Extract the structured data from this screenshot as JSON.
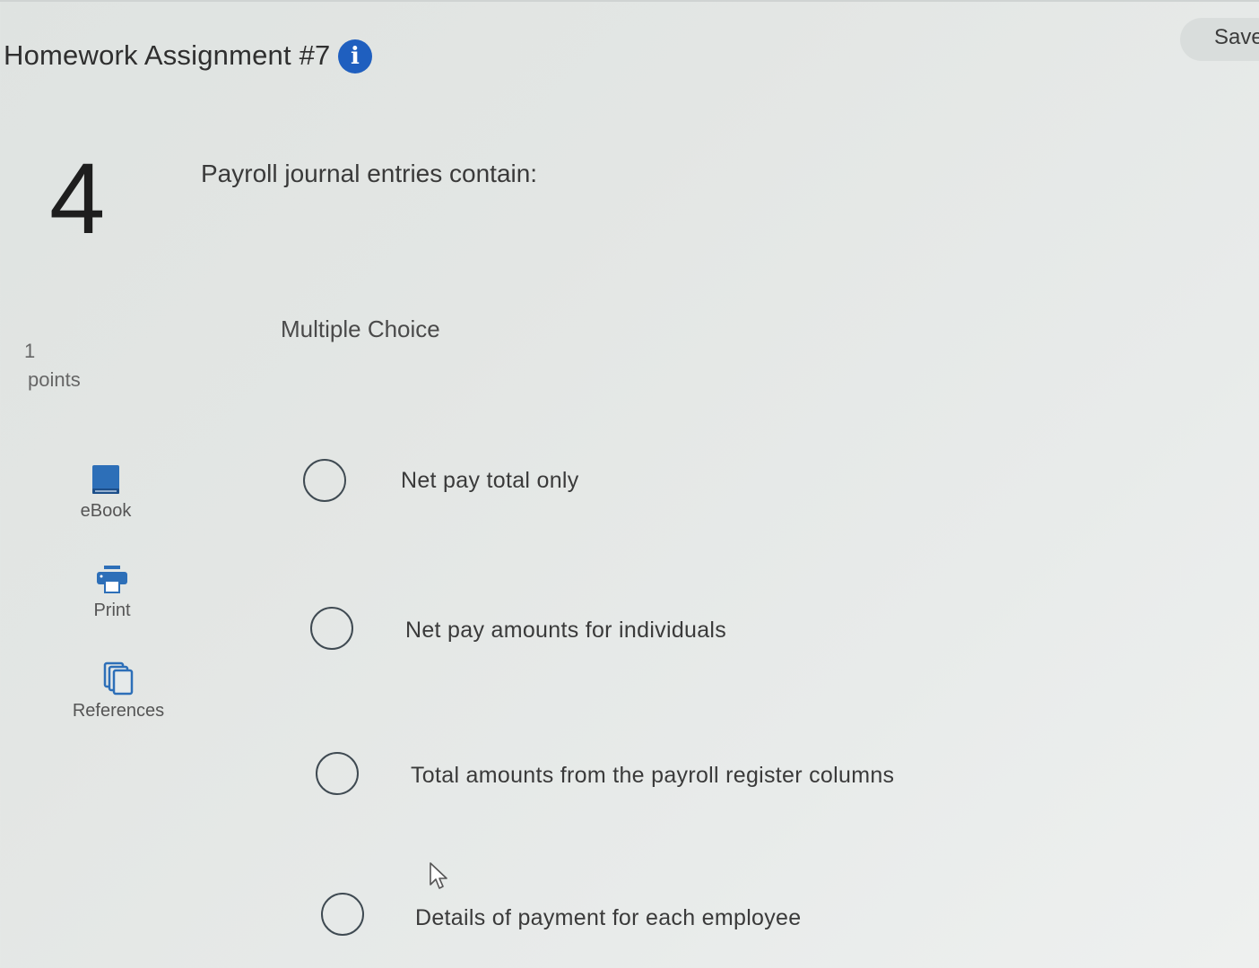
{
  "header": {
    "title": "Homework Assignment #7",
    "info_icon": "info-icon",
    "save_label": "Save"
  },
  "question": {
    "number": "4",
    "prompt": "Payroll journal entries contain:",
    "points_value": "1",
    "points_label": "points",
    "type": "Multiple Choice"
  },
  "tools": [
    {
      "icon": "book-icon",
      "label": "eBook"
    },
    {
      "icon": "printer-icon",
      "label": "Print"
    },
    {
      "icon": "references-icon",
      "label": "References"
    }
  ],
  "options": [
    {
      "text": "Net pay total only"
    },
    {
      "text": "Net pay amounts for individuals"
    },
    {
      "text": "Total amounts from the payroll register columns"
    },
    {
      "text": "Details of payment for each employee"
    }
  ],
  "colors": {
    "accent": "#1f5fbf",
    "icon_blue": "#2d6fb8",
    "text": "#3a3a3a"
  }
}
